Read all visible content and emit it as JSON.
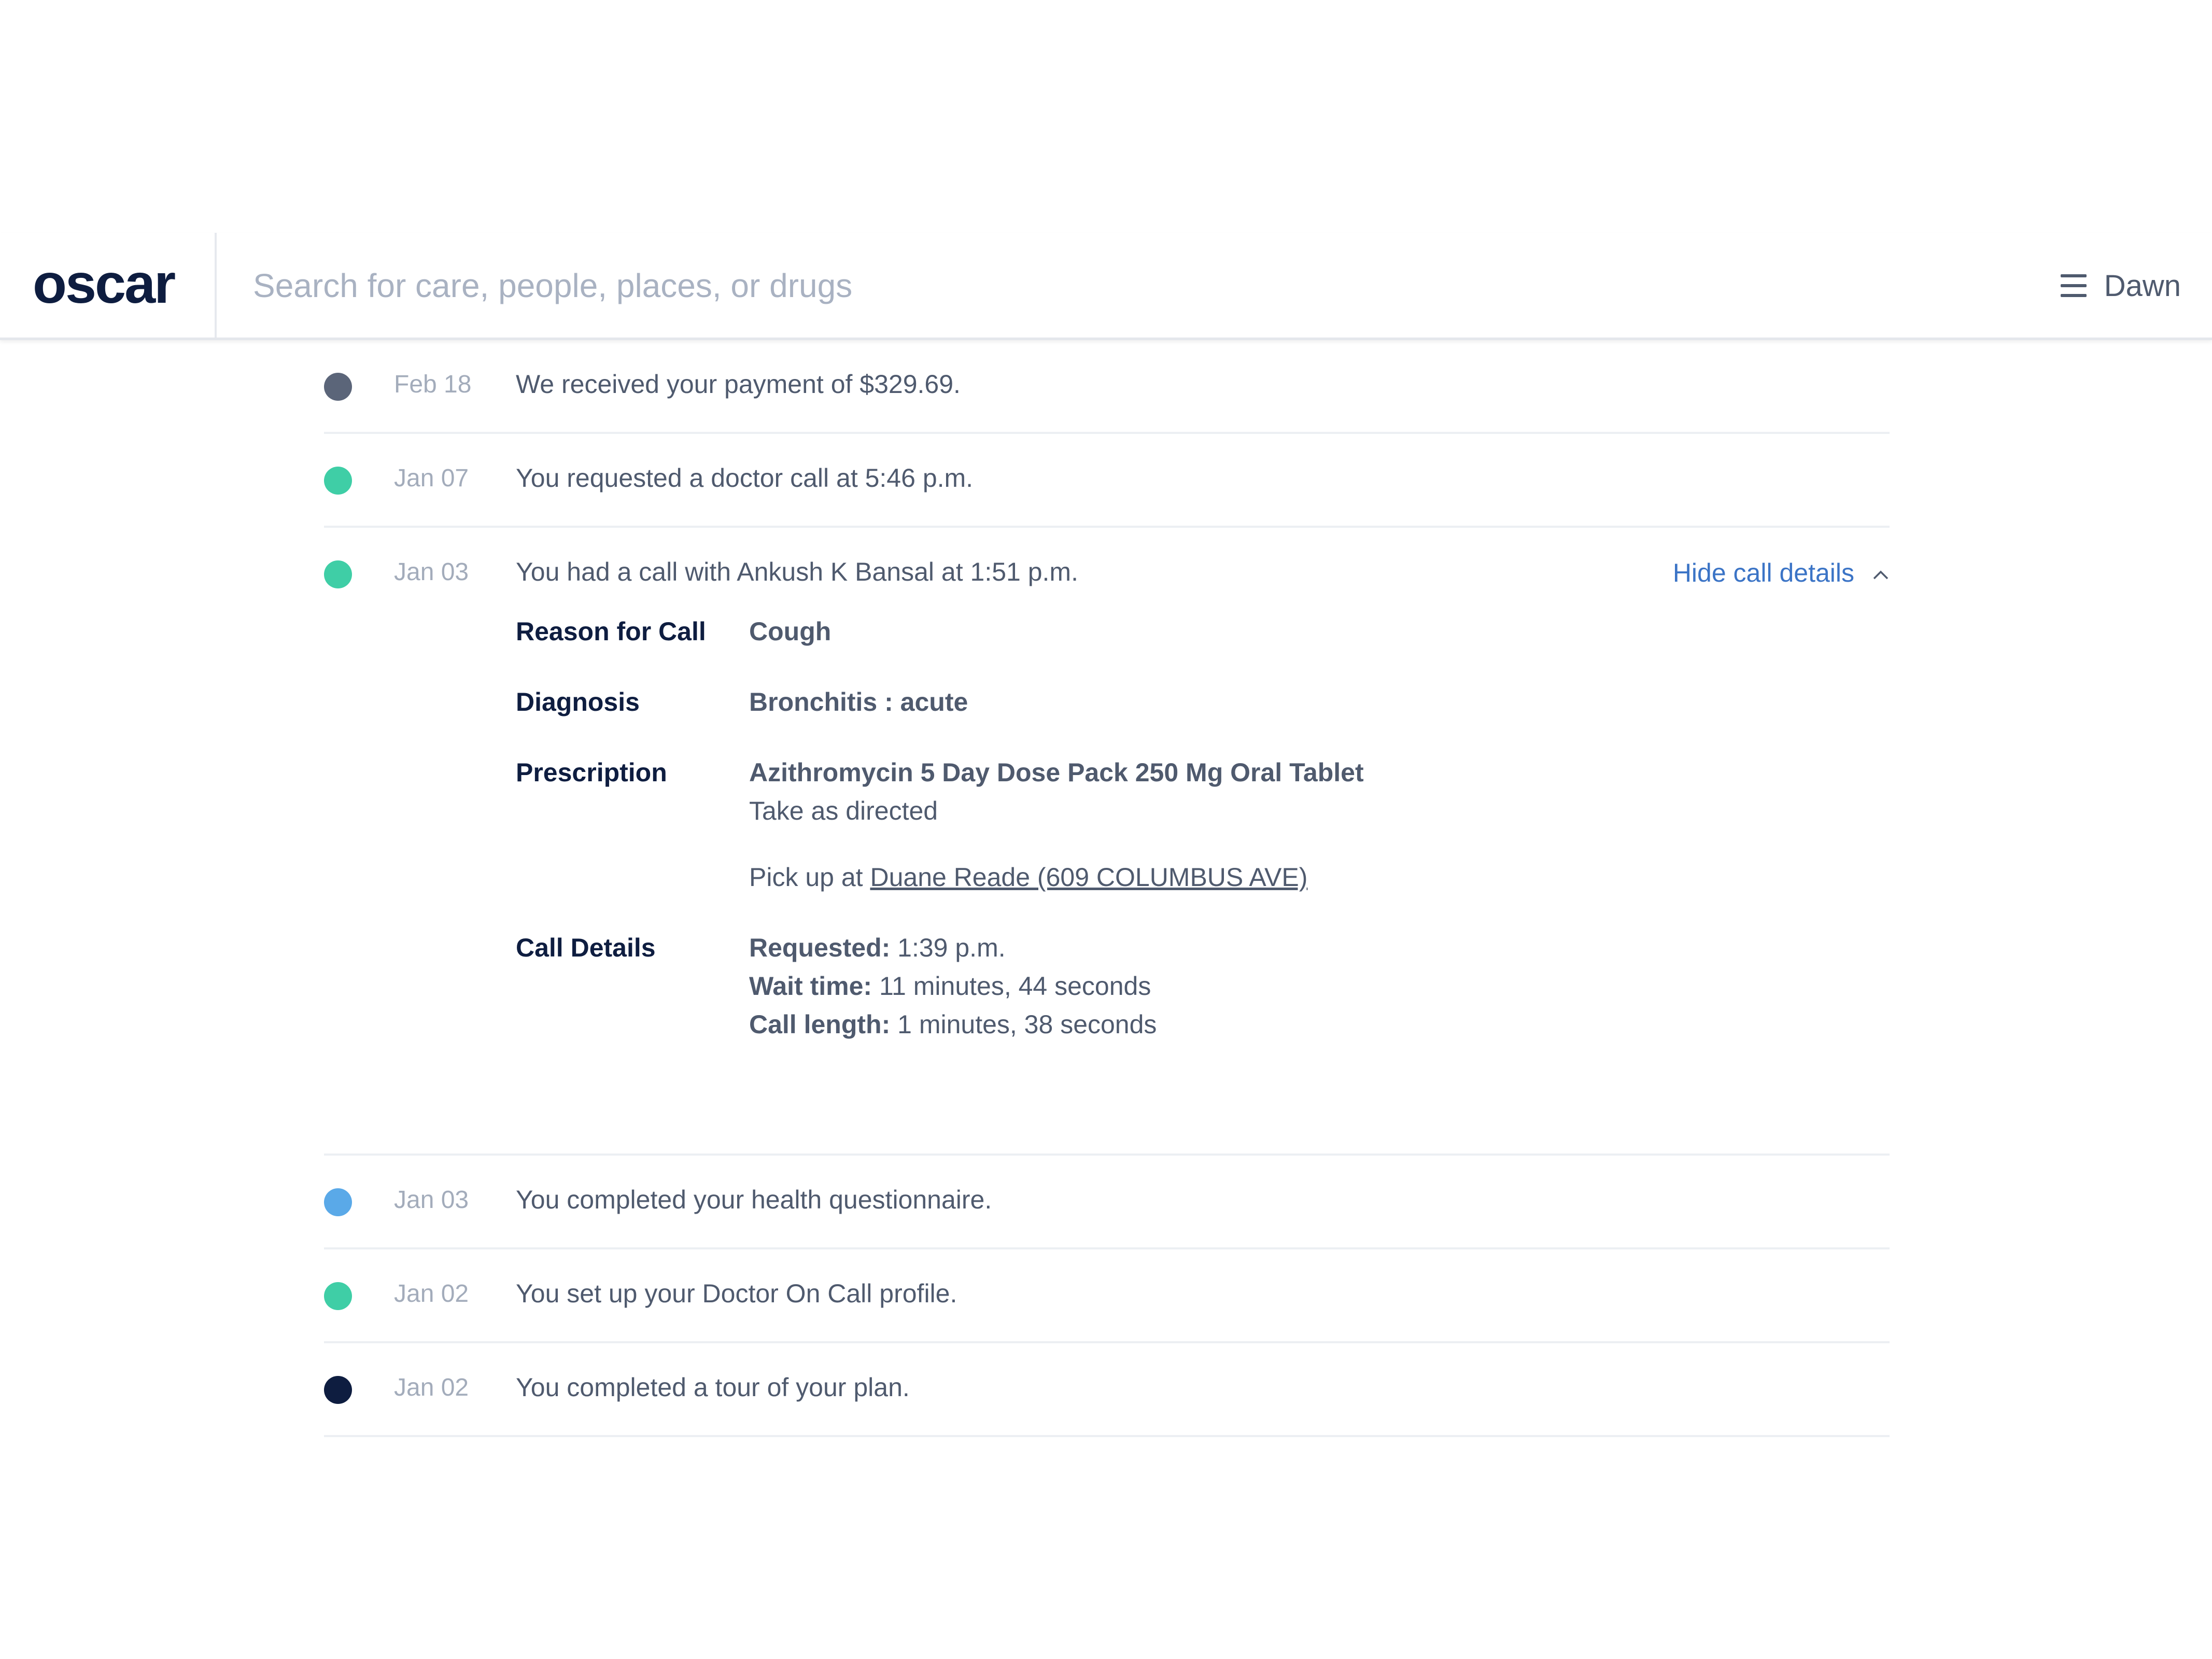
{
  "header": {
    "logo": "oscar",
    "search_placeholder": "Search for care, people, places, or drugs",
    "user_name": "Dawn",
    "menu_icon": "hamburger-icon"
  },
  "colors": {
    "navy": "#0e1d40",
    "slate": "#5b6579",
    "teal": "#3fcea6",
    "blue": "#5aa9e8",
    "link": "#3b74c6"
  },
  "timeline": [
    {
      "date": "Feb 18",
      "text": "We received your payment of $329.69.",
      "dot_color": "#5b6579"
    },
    {
      "date": "Jan 07",
      "text": "You requested a doctor call at 5:46 p.m.",
      "dot_color": "#3fcea6"
    },
    {
      "date": "Jan 03",
      "text": "You had a call with Ankush K Bansal at 1:51 p.m.",
      "dot_color": "#3fcea6"
    },
    {
      "date": "Jan 03",
      "text": "You completed your health questionnaire.",
      "dot_color": "#5aa9e8"
    },
    {
      "date": "Jan 02",
      "text": "You set up your Doctor On Call profile.",
      "dot_color": "#3fcea6"
    },
    {
      "date": "Jan 02",
      "text": "You completed a tour of your plan.",
      "dot_color": "#0e1d40"
    }
  ],
  "call_details": {
    "toggle_label": "Hide call details",
    "reason_label": "Reason for Call",
    "reason_value": "Cough",
    "diagnosis_label": "Diagnosis",
    "diagnosis_value": "Bronchitis : acute",
    "prescription_label": "Prescription",
    "prescription_name": "Azithromycin 5 Day Dose Pack 250 Mg Oral Tablet",
    "prescription_instructions": "Take as directed",
    "pickup_prefix": "Pick up at",
    "pickup_location": "Duane Reade (609 COLUMBUS AVE)",
    "call_details_label": "Call Details",
    "requested_label": "Requested:",
    "requested_value": "1:39 p.m.",
    "wait_label": "Wait time:",
    "wait_value": "11 minutes, 44 seconds",
    "length_label": "Call length:",
    "length_value": "1 minutes, 38 seconds"
  }
}
